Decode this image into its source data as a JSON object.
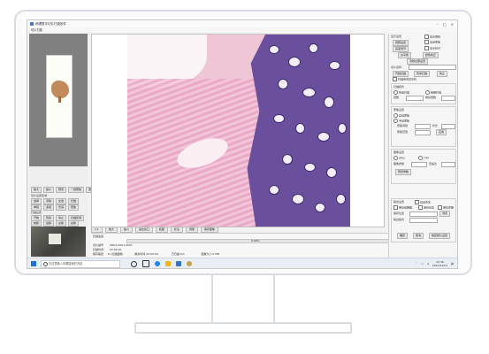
{
  "window": {
    "title": "病理数字切片扫描软件",
    "menu": "切片扫描"
  },
  "left_panel": {
    "row1_buttons": [
      "放大",
      "缩小",
      "预览",
      "一键聚焦",
      "更换切片"
    ],
    "section_label": "切片设置区域",
    "row2_buttons": [
      "选择",
      "清除",
      "全选",
      "扫描"
    ],
    "row3_buttons": [
      "单层",
      "多层",
      "景深",
      "聚焦"
    ],
    "scan_label": "扫描设置",
    "row4_buttons": [
      "开始",
      "暂停",
      "停止",
      "扫描区域"
    ],
    "row5_buttons": [
      "前移",
      "后移",
      "左移",
      "右移"
    ]
  },
  "viewer_toolbar": [
    "1:1",
    "放大",
    "缩小",
    "适合窗口",
    "截图",
    "标注",
    "测量",
    "保存图像"
  ],
  "status": {
    "line1": "扫描速度",
    "progress_pct": "0.00%",
    "progress_value": 0.0,
    "line2": "切片编号",
    "line2_value": "SM01-0001-0001",
    "line3": "扫描时间",
    "line3_value": "00:00:00",
    "line4": "保存路径",
    "line4_value": "D:\\扫描图像\\",
    "line5_a": "剩余时间 00:00:00",
    "line5_b": "已扫描 0/0",
    "line5_c": "图像大小 0 MB"
  },
  "right_panel": {
    "group1_title": "显示设置",
    "cb1": "显示网格",
    "cb2": "自动聚焦",
    "btn_a": "视野设置",
    "btn_b": "亮度调节",
    "cb3": "显示标尺",
    "btn_c": "白平衡",
    "btn_d": "颜色校正",
    "btn_e": "清除全部设置",
    "field_label": "切片名称",
    "btn_f": "开始扫描",
    "btn_g": "暂停扫描",
    "btn_h": "停止",
    "cb4": "扫描完成后关机",
    "group2_title": "扫描模式",
    "opt1": "快速扫描",
    "opt2": "精细扫描",
    "group3_title": "聚焦设置",
    "opt3": "自动聚焦",
    "opt4": "手动聚焦",
    "lbl_dist": "聚焦间隔",
    "lbl_range": "聚焦范围",
    "lbl_step": "步长",
    "lbl_layers": "层数",
    "lbl_mag": "物镜倍数",
    "btn_i": "应用",
    "group4_title": "图像设置",
    "opt5": "JPEG",
    "opt6": "TIFF",
    "lbl_quality": "图像质量",
    "lbl_compress": "压缩比",
    "btn_j": "预览参数",
    "group5_title": "输出设置",
    "cb5": "自动命名",
    "cb6": "保存缩略图",
    "cb7": "保存标签",
    "cb8": "保存原图",
    "lbl_path": "保存位置",
    "lbl_format": "输出格式",
    "btn_k": "浏览",
    "btn_l": "确定",
    "btn_m": "取消",
    "btn_n": "恢复默认设置"
  },
  "taskbar": {
    "search_placeholder": "在这里输入你要搜索的内容",
    "time": "10:36",
    "date": "2021/01/01"
  }
}
